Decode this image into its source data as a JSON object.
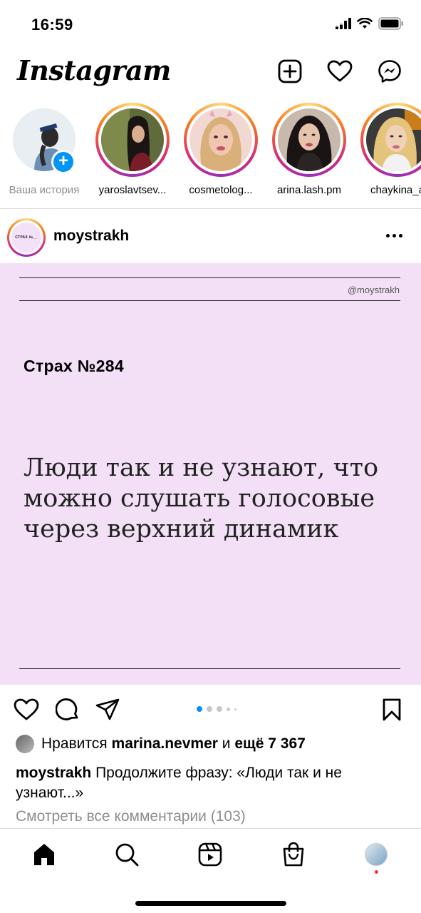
{
  "status_bar": {
    "time": "16:59",
    "icons": [
      "signal-icon",
      "wifi-icon",
      "battery-icon"
    ]
  },
  "header": {
    "logo": "Instagram",
    "actions": [
      "new-post-icon",
      "heart-icon",
      "messenger-icon"
    ]
  },
  "stories": [
    {
      "label": "Ваша история",
      "own": true
    },
    {
      "label": "yaroslavtsev..."
    },
    {
      "label": "cosmetolog..."
    },
    {
      "label": "arina.lash.pm"
    },
    {
      "label": "chaykina_a"
    }
  ],
  "post": {
    "username": "moystrakh",
    "avatar_text": "СТРАХ №__",
    "image": {
      "handle": "@moystrakh",
      "title": "Страх №284",
      "quote": "Люди так и не узнают, что можно слушать голосовые через верхний динамик"
    },
    "carousel": {
      "total_dots": 5,
      "active_index": 0
    },
    "likes": {
      "prefix": "Нравится",
      "user": "marina.nevmer",
      "connector": "и",
      "more": "ещё 7 367"
    },
    "caption": {
      "username": "moystrakh",
      "text": "Продолжите фразу: «Люди так и не узнают...»"
    },
    "view_comments": "Смотреть все комментарии (103)"
  },
  "bottom_nav": [
    "home-icon",
    "search-icon",
    "reels-icon",
    "shop-icon",
    "profile-avatar"
  ],
  "colors": {
    "accent_blue": "#0095f6",
    "post_background": "#f3e0f7",
    "notification_red": "#ff3040"
  }
}
